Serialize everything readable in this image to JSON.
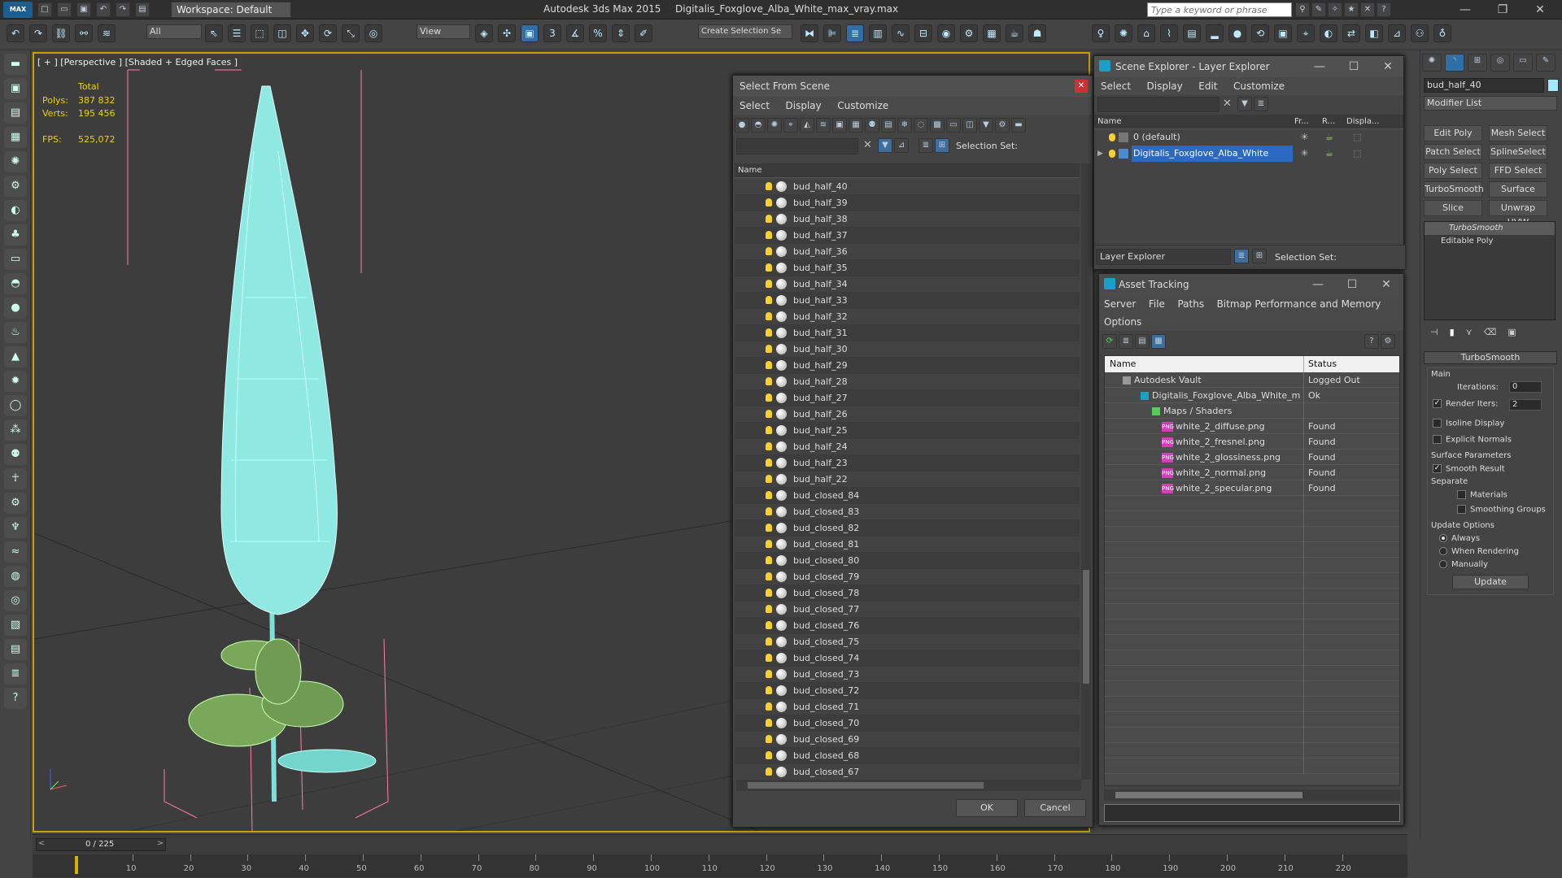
{
  "app": {
    "title": "Autodesk 3ds Max  2015",
    "file": "Digitalis_Foxglove_Alba_White_max_vray.max",
    "workspace": "Workspace: Default",
    "search_placeholder": "Type a keyword or phrase",
    "logo": "MAX"
  },
  "toolbar": {
    "filter_value": "All",
    "view_value": "View",
    "selection_set_value": "Create Selection Se"
  },
  "viewport": {
    "label": "[ + ] [Perspective ] [Shaded + Edged Faces ]",
    "stats_total": "Total",
    "polys_label": "Polys:",
    "polys_value": "387 832",
    "verts_label": "Verts:",
    "verts_value": "195 456",
    "fps_label": "FPS:",
    "fps_value": "525,072"
  },
  "select_from_scene": {
    "title": "Select From Scene",
    "menu": [
      "Select",
      "Display",
      "Customize"
    ],
    "selection_set_label": "Selection Set:",
    "column_name": "Name",
    "items": [
      "bud_half_40",
      "bud_half_39",
      "bud_half_38",
      "bud_half_37",
      "bud_half_36",
      "bud_half_35",
      "bud_half_34",
      "bud_half_33",
      "bud_half_32",
      "bud_half_31",
      "bud_half_30",
      "bud_half_29",
      "bud_half_28",
      "bud_half_27",
      "bud_half_26",
      "bud_half_25",
      "bud_half_24",
      "bud_half_23",
      "bud_half_22",
      "bud_closed_84",
      "bud_closed_83",
      "bud_closed_82",
      "bud_closed_81",
      "bud_closed_80",
      "bud_closed_79",
      "bud_closed_78",
      "bud_closed_77",
      "bud_closed_76",
      "bud_closed_75",
      "bud_closed_74",
      "bud_closed_73",
      "bud_closed_72",
      "bud_closed_71",
      "bud_closed_70",
      "bud_closed_69",
      "bud_closed_68",
      "bud_closed_67"
    ],
    "ok_label": "OK",
    "cancel_label": "Cancel"
  },
  "scene_explorer": {
    "title": "Scene Explorer - Layer Explorer",
    "menu": [
      "Select",
      "Display",
      "Edit",
      "Customize"
    ],
    "columns": [
      "Name",
      "Fr...",
      "R...",
      "Displa..."
    ],
    "layers": [
      "0 (default)",
      "Digitalis_Foxglove_Alba_White"
    ],
    "footer_label": "Layer Explorer",
    "selection_set_label": "Selection Set:"
  },
  "asset_tracking": {
    "title": "Asset Tracking",
    "menu": [
      "Server",
      "File",
      "Paths",
      "Bitmap Performance and Memory"
    ],
    "menu2": "Options",
    "columns": [
      "Name",
      "Status"
    ],
    "rows": [
      {
        "name": "Autodesk Vault",
        "status": "Logged Out"
      },
      {
        "name": "Digitalis_Foxglove_Alba_White_max_vray....",
        "status": "Ok"
      },
      {
        "name": "Maps / Shaders",
        "status": ""
      },
      {
        "name": "white_2_diffuse.png",
        "status": "Found"
      },
      {
        "name": "white_2_fresnel.png",
        "status": "Found"
      },
      {
        "name": "white_2_glossiness.png",
        "status": "Found"
      },
      {
        "name": "white_2_normal.png",
        "status": "Found"
      },
      {
        "name": "white_2_specular.png",
        "status": "Found"
      }
    ],
    "png_badge": "PNG"
  },
  "command_panel": {
    "object_name": "bud_half_40",
    "modifier_list": "Modifier List",
    "mod_buttons": [
      "Edit Poly",
      "Mesh Select",
      "Patch Select",
      "SplineSelect",
      "Poly Select",
      "FFD Select",
      "TurboSmooth",
      "Surface Select",
      "Slice",
      "Unwrap UVW"
    ],
    "stack": [
      "TurboSmooth",
      "Editable Poly"
    ],
    "rollout_title": "TurboSmooth",
    "main_label": "Main",
    "iterations_label": "Iterations:",
    "iterations_value": "0",
    "render_iters_label": "Render Iters:",
    "render_iters_value": "2",
    "isoline_label": "Isoline Display",
    "explicit_normals_label": "Explicit Normals",
    "surface_params_label": "Surface Parameters",
    "smooth_result_label": "Smooth Result",
    "separate_label": "Separate",
    "materials_label": "Materials",
    "smoothing_groups_label": "Smoothing Groups",
    "update_options_label": "Update Options",
    "always_label": "Always",
    "when_rendering_label": "When Rendering",
    "manually_label": "Manually",
    "update_button": "Update"
  },
  "timeline": {
    "frame_display": "0 / 225",
    "ticks": [
      "10",
      "20",
      "30",
      "40",
      "50",
      "60",
      "70",
      "80",
      "90",
      "100",
      "110",
      "120",
      "130",
      "140",
      "150",
      "160",
      "170",
      "180",
      "190",
      "200",
      "210",
      "220"
    ]
  }
}
